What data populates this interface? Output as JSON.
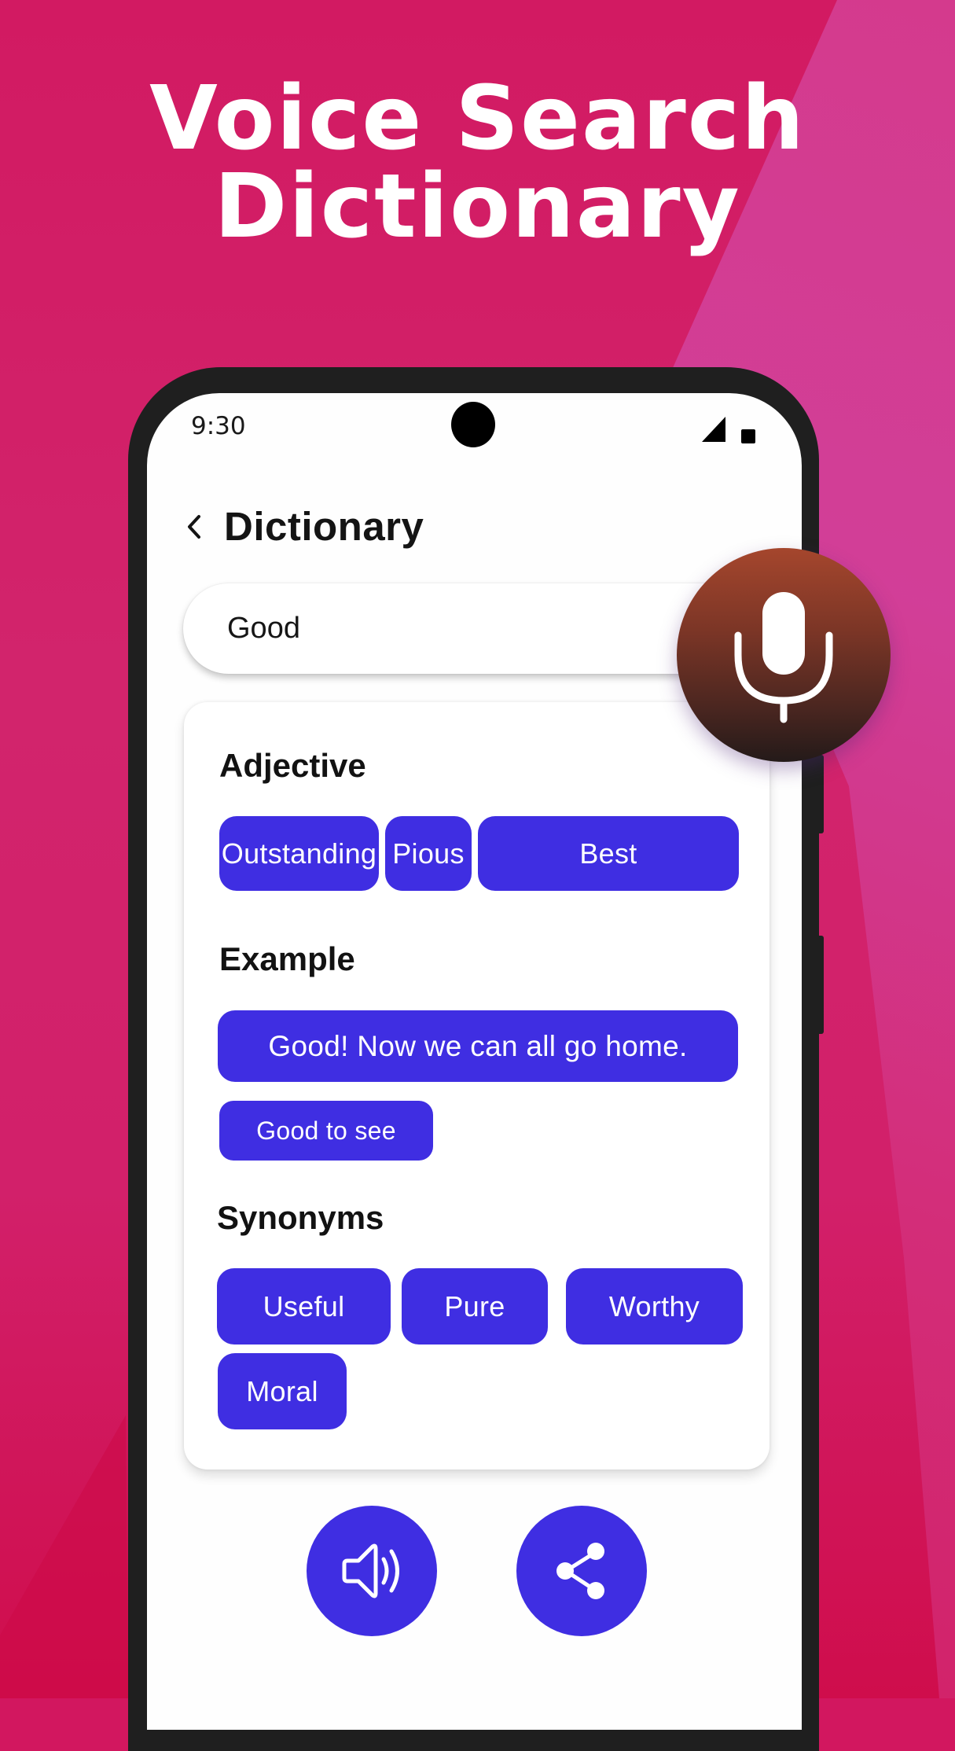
{
  "headline": {
    "line1": "Voice Search",
    "line2": "Dictionary"
  },
  "status_bar": {
    "time": "9:30",
    "icons": [
      "signal-icon",
      "battery-icon"
    ]
  },
  "app_bar": {
    "back_icon": "chevron-left-icon",
    "title": "Dictionary"
  },
  "search": {
    "value": "Good",
    "voice_button_icon": "microphone-icon"
  },
  "result": {
    "part_of_speech": {
      "title": "Adjective",
      "chips": [
        "Outstanding",
        "Pious",
        "Best"
      ]
    },
    "example": {
      "title": "Example",
      "chips": [
        "Good! Now we can all go home.",
        "Good to see"
      ]
    },
    "synonyms": {
      "title": "Synonyms",
      "chips": [
        "Useful",
        "Pure",
        "Worthy",
        "Moral"
      ]
    }
  },
  "actions": {
    "speak_icon": "speaker-icon",
    "share_icon": "share-icon"
  },
  "colors": {
    "accent": "#3f2ee2",
    "background": "#d2175f",
    "mic_gradient_top": "#a5462d",
    "mic_gradient_bottom": "#241a19"
  }
}
